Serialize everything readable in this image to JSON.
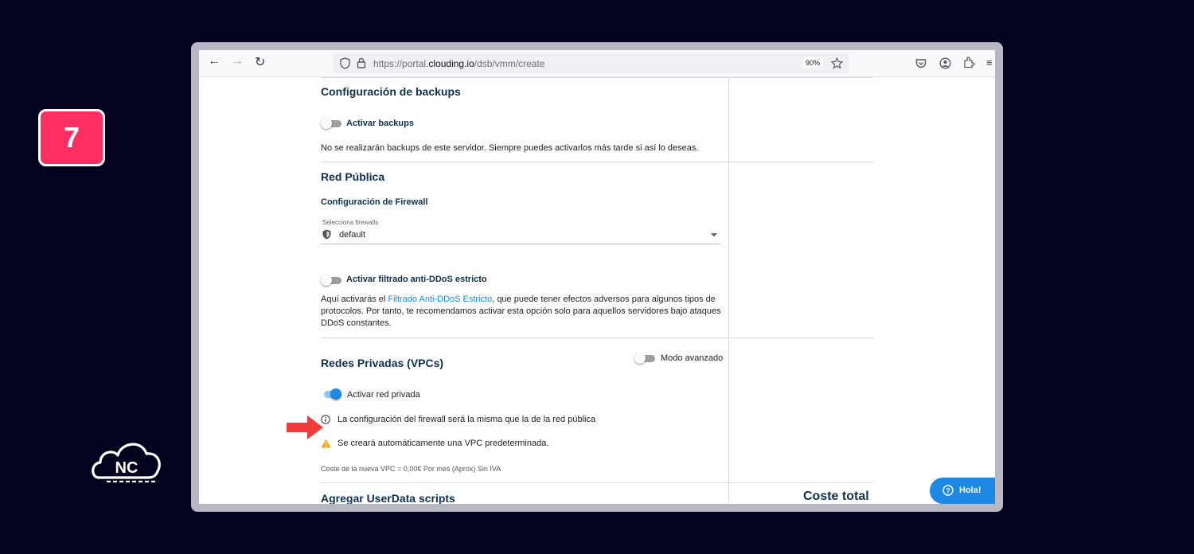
{
  "step": {
    "number": "7"
  },
  "logo": {
    "text": "NC"
  },
  "browser": {
    "url_prefix": "https://portal.",
    "url_domain": "clouding.io",
    "url_path": "/dsb/vmm/create",
    "zoom": "90%"
  },
  "backups": {
    "title": "Configuración de backups",
    "toggle_label": "Activar backups",
    "toggle_on": false,
    "description": "No se realizarán backups de este servidor. Siempre puedes activarlos más tarde si así lo deseas."
  },
  "public_network": {
    "title": "Red Pública",
    "firewall_title": "Configuración de Firewall",
    "select_label": "Selecciona firewalls",
    "select_value": "default",
    "ddos_toggle_label": "Activar filtrado anti-DDoS estricto",
    "ddos_toggle_on": false,
    "ddos_desc_before": "Aquí activarás el ",
    "ddos_desc_link": "Filtrado Anti-DDoS Estricto",
    "ddos_desc_line1_after": ", que puede tener efectos adversos para algunos tipos de",
    "ddos_desc_line2": "protocolos. Por tanto, te recomendamos activar esta opción solo para aquellos servidores bajo ataques",
    "ddos_desc_line3": "DDoS constantes."
  },
  "private_network": {
    "title": "Redes Privadas (VPCs)",
    "advanced_label": "Modo avanzado",
    "advanced_on": false,
    "toggle_label": "Activar red privada",
    "toggle_on": true,
    "info_text": "La configuración del firewall será la misma que la de la red pública",
    "warning_text": "Se creará automáticamente una VPC predeterminada.",
    "cost_text": "Coste de la nueva VPC = 0,00€ Por mes (Aprox) Sin IVA"
  },
  "userdata": {
    "title": "Agregar UserData scripts"
  },
  "summary": {
    "total_label": "Coste total"
  },
  "chat": {
    "label": "Hola!"
  },
  "colors": {
    "background": "#03021f",
    "badge": "#ff2e63",
    "accent_blue": "#1e88e5",
    "heading": "#0f2f4b",
    "arrow_red": "#f23c3c",
    "warning": "#f5a623"
  },
  "icons": [
    "back-arrow-icon",
    "forward-arrow-icon",
    "reload-icon",
    "shield-icon",
    "lock-icon",
    "star-icon",
    "pocket-icon",
    "account-icon",
    "extensions-icon",
    "menu-icon",
    "firewall-shield-icon",
    "dropdown-caret-icon",
    "info-icon",
    "warning-icon",
    "help-icon",
    "red-arrow-icon"
  ]
}
